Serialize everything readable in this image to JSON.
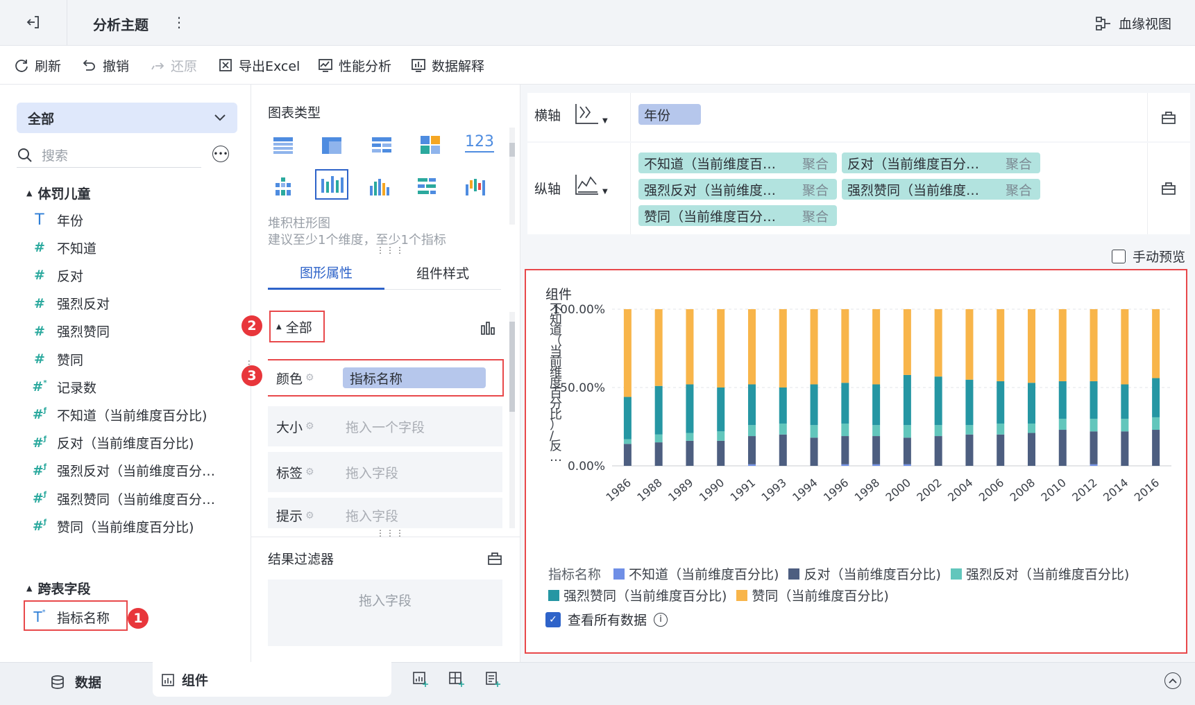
{
  "titlebar": {
    "title": "分析主题",
    "lineage_label": "血缘视图"
  },
  "toolbar": {
    "refresh": "刷新",
    "undo": "撤销",
    "redo": "还原",
    "export_excel": "导出Excel",
    "perf_analysis": "性能分析",
    "data_explain": "数据解释"
  },
  "left": {
    "dropdown_value": "全部",
    "search_placeholder": "搜索",
    "groups": [
      {
        "name": "体罚儿童",
        "fields": [
          {
            "label": "年份",
            "type": "text"
          },
          {
            "label": "不知道",
            "type": "num"
          },
          {
            "label": "反对",
            "type": "num"
          },
          {
            "label": "强烈反对",
            "type": "num"
          },
          {
            "label": "强烈赞同",
            "type": "num"
          },
          {
            "label": "赞同",
            "type": "num"
          },
          {
            "label": "记录数",
            "type": "num-star"
          },
          {
            "label": "不知道（当前维度百分比)",
            "type": "calc"
          },
          {
            "label": "反对（当前维度百分比)",
            "type": "calc"
          },
          {
            "label": "强烈反对（当前维度百分…",
            "type": "calc"
          },
          {
            "label": "强烈赞同（当前维度百分…",
            "type": "calc"
          },
          {
            "label": "赞同（当前维度百分比)",
            "type": "calc"
          }
        ]
      },
      {
        "name": "跨表字段",
        "fields": [
          {
            "label": "指标名称",
            "type": "text-star"
          }
        ]
      }
    ],
    "badge1": "1"
  },
  "middle": {
    "chart_type_title": "图表类型",
    "chart_name": "堆积柱形图",
    "chart_hint": "建议至少1个维度，至少1个指标",
    "tab_graphic": "图形属性",
    "tab_style": "组件样式",
    "all_label": "全部",
    "badge2": "2",
    "badge3": "3",
    "color_label": "颜色",
    "color_value": "指标名称",
    "size_label": "大小",
    "size_placeholder": "拖入一个字段",
    "tag_label": "标签",
    "tag_placeholder": "拖入字段",
    "tip_label": "提示",
    "tip_placeholder": "拖入字段",
    "filter_title": "结果过滤器",
    "filter_placeholder": "拖入字段"
  },
  "axes": {
    "x_label": "横轴",
    "x_field": "年份",
    "y_label": "纵轴",
    "y_fields": [
      {
        "name": "不知道（当前维度百…",
        "agg": "聚合"
      },
      {
        "name": "反对（当前维度百分…",
        "agg": "聚合"
      },
      {
        "name": "强烈反对（当前维度…",
        "agg": "聚合"
      },
      {
        "name": "强烈赞同（当前维度…",
        "agg": "聚合"
      },
      {
        "name": "赞同（当前维度百分…",
        "agg": "聚合"
      }
    ],
    "manual_preview": "手动预览"
  },
  "chart_panel": {
    "title": "组件",
    "legend_title": "指标名称",
    "view_all": "查看所有数据",
    "y_axis_title": "不知道（当前维度百分比）/反…"
  },
  "chart_data": {
    "type": "bar",
    "stacked": true,
    "title": "组件",
    "xlabel": "",
    "ylabel": "不知道（当前维度百分比）/反…",
    "ylim": [
      0,
      1
    ],
    "y_ticks": [
      "0.00%",
      "50.00%",
      "100.00%"
    ],
    "grid": true,
    "legend_position": "bottom",
    "categories": [
      "1986",
      "1988",
      "1989",
      "1990",
      "1991",
      "1993",
      "1994",
      "1996",
      "1998",
      "2000",
      "2002",
      "2004",
      "2006",
      "2008",
      "2010",
      "2012",
      "2014",
      "2016"
    ],
    "series": [
      {
        "name": "不知道（当前维度百分比)",
        "color": "#6f8fe6",
        "values": [
          0.0,
          0.0,
          0.0,
          0.0,
          0.01,
          0.0,
          0.0,
          0.01,
          0.01,
          0.01,
          0.0,
          0.0,
          0.0,
          0.0,
          0.0,
          0.01,
          0.0,
          0.0
        ]
      },
      {
        "name": "反对（当前维度百分比)",
        "color": "#4d5e80",
        "values": [
          0.14,
          0.15,
          0.16,
          0.16,
          0.18,
          0.2,
          0.18,
          0.18,
          0.18,
          0.17,
          0.19,
          0.2,
          0.2,
          0.21,
          0.23,
          0.21,
          0.22,
          0.23
        ]
      },
      {
        "name": "强烈反对（当前维度百分比)",
        "color": "#62c6bc",
        "values": [
          0.03,
          0.05,
          0.05,
          0.06,
          0.07,
          0.07,
          0.08,
          0.08,
          0.07,
          0.08,
          0.07,
          0.06,
          0.07,
          0.06,
          0.07,
          0.08,
          0.08,
          0.08
        ]
      },
      {
        "name": "强烈赞同（当前维度百分比)",
        "color": "#2596a3",
        "values": [
          0.27,
          0.31,
          0.31,
          0.28,
          0.26,
          0.23,
          0.26,
          0.26,
          0.26,
          0.32,
          0.31,
          0.29,
          0.27,
          0.26,
          0.24,
          0.24,
          0.22,
          0.25
        ]
      },
      {
        "name": "赞同（当前维度百分比)",
        "color": "#f8b54a",
        "values": [
          0.56,
          0.49,
          0.48,
          0.5,
          0.48,
          0.5,
          0.48,
          0.47,
          0.48,
          0.42,
          0.43,
          0.45,
          0.46,
          0.47,
          0.46,
          0.46,
          0.48,
          0.44
        ]
      }
    ]
  },
  "bottom": {
    "data_tab": "数据",
    "component_tab": "组件"
  }
}
